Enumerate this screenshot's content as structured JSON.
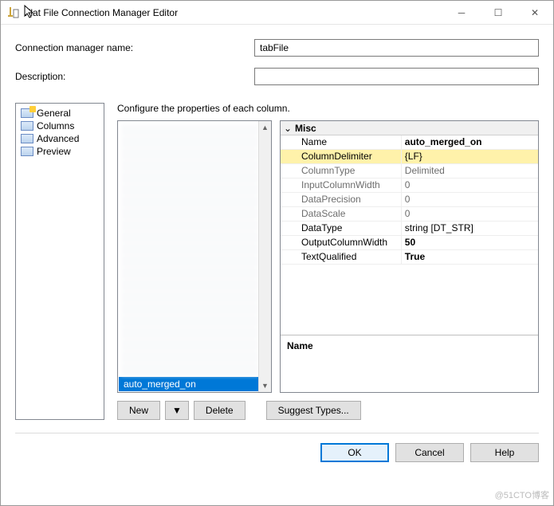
{
  "window": {
    "title": "Flat File Connection Manager Editor"
  },
  "form": {
    "conn_label": "Connection manager name:",
    "conn_value": "tabFile",
    "desc_label": "Description:",
    "desc_value": ""
  },
  "sidebar": {
    "items": [
      {
        "label": "General"
      },
      {
        "label": "Columns"
      },
      {
        "label": "Advanced"
      },
      {
        "label": "Preview"
      }
    ]
  },
  "main": {
    "hint": "Configure the properties of each column.",
    "selected_item": "auto_merged_on"
  },
  "propgrid": {
    "category": "Misc",
    "rows": [
      {
        "k": "Name",
        "v": "auto_merged_on",
        "ro": false,
        "hl": false,
        "bold": true
      },
      {
        "k": "ColumnDelimiter",
        "v": "{LF}",
        "ro": false,
        "hl": true,
        "bold": false
      },
      {
        "k": "ColumnType",
        "v": "Delimited",
        "ro": true,
        "hl": false,
        "bold": false
      },
      {
        "k": "InputColumnWidth",
        "v": "0",
        "ro": true,
        "hl": false,
        "bold": false
      },
      {
        "k": "DataPrecision",
        "v": "0",
        "ro": true,
        "hl": false,
        "bold": false
      },
      {
        "k": "DataScale",
        "v": "0",
        "ro": true,
        "hl": false,
        "bold": false
      },
      {
        "k": "DataType",
        "v": "string [DT_STR]",
        "ro": false,
        "hl": false,
        "bold": false
      },
      {
        "k": "OutputColumnWidth",
        "v": "50",
        "ro": false,
        "hl": false,
        "bold": true
      },
      {
        "k": "TextQualified",
        "v": "True",
        "ro": false,
        "hl": false,
        "bold": true
      }
    ],
    "desc_name": "Name",
    "desc_text": ""
  },
  "buttons": {
    "new": "New",
    "delete": "Delete",
    "suggest": "Suggest Types...",
    "ok": "OK",
    "cancel": "Cancel",
    "help": "Help"
  },
  "watermark": "@51CTO博客"
}
